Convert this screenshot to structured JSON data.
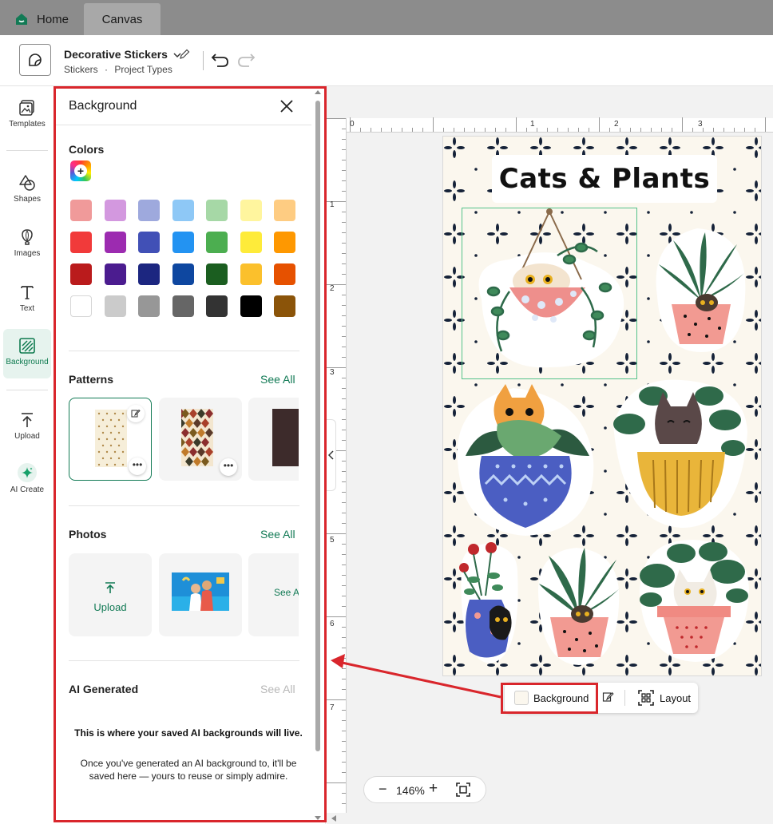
{
  "tabs": [
    {
      "label": "Home"
    },
    {
      "label": "Canvas"
    }
  ],
  "header": {
    "project_title": "Decorative Stickers",
    "crumb_category": "Stickers",
    "crumb_separator": "·",
    "crumb_type": "Project Types"
  },
  "rail": {
    "items": [
      {
        "label": "Templates",
        "icon": "templates-icon"
      },
      {
        "label": "Shapes",
        "icon": "shapes-icon"
      },
      {
        "label": "Images",
        "icon": "images-icon"
      },
      {
        "label": "Text",
        "icon": "text-icon"
      },
      {
        "label": "Background",
        "icon": "background-icon",
        "active": true
      },
      {
        "label": "Upload",
        "icon": "upload-icon"
      },
      {
        "label": "AI Create",
        "icon": "sparkle-icon"
      }
    ]
  },
  "panel": {
    "title": "Background",
    "colors": {
      "title": "Colors",
      "swatches": [
        "#F09A9A",
        "#D398DF",
        "#9EA9DD",
        "#8EC8F6",
        "#A6D8A6",
        "#FFF59E",
        "#FECC82",
        "#F13A3A",
        "#9C2BB0",
        "#4150B6",
        "#2393F2",
        "#4CAE50",
        "#FEEB3A",
        "#FE9801",
        "#BA1B1C",
        "#4B1C8F",
        "#1C2680",
        "#0E47A0",
        "#1B5E20",
        "#FBC02C",
        "#E65100",
        "#FFFFFF",
        "#CBCBCB",
        "#979797",
        "#666666",
        "#333333",
        "#000000",
        "#8B5409"
      ]
    },
    "patterns": {
      "title": "Patterns",
      "see_all": "See All"
    },
    "photos": {
      "title": "Photos",
      "see_all": "See All",
      "upload_label": "Upload",
      "see_all_card": "See All"
    },
    "ai_generated": {
      "title": "AI Generated",
      "see_all": "See All",
      "empty_title": "This is where your saved AI backgrounds will live.",
      "empty_text": "Once you've generated an AI background to, it'll be saved here — yours to reuse or simply admire."
    }
  },
  "canvas": {
    "title": "Cats & Plants",
    "ruler_top": [
      "0",
      "1",
      "2",
      "3"
    ],
    "ruler_left": [
      "1",
      "2",
      "3",
      "4",
      "5",
      "6",
      "7"
    ],
    "background_color": "#FBF7EE"
  },
  "context_toolbar": {
    "background_label": "Background",
    "layout_label": "Layout"
  },
  "zoom": {
    "value": "146%"
  },
  "colors": {
    "accent": "#127A55",
    "highlight": "#D9262C"
  }
}
